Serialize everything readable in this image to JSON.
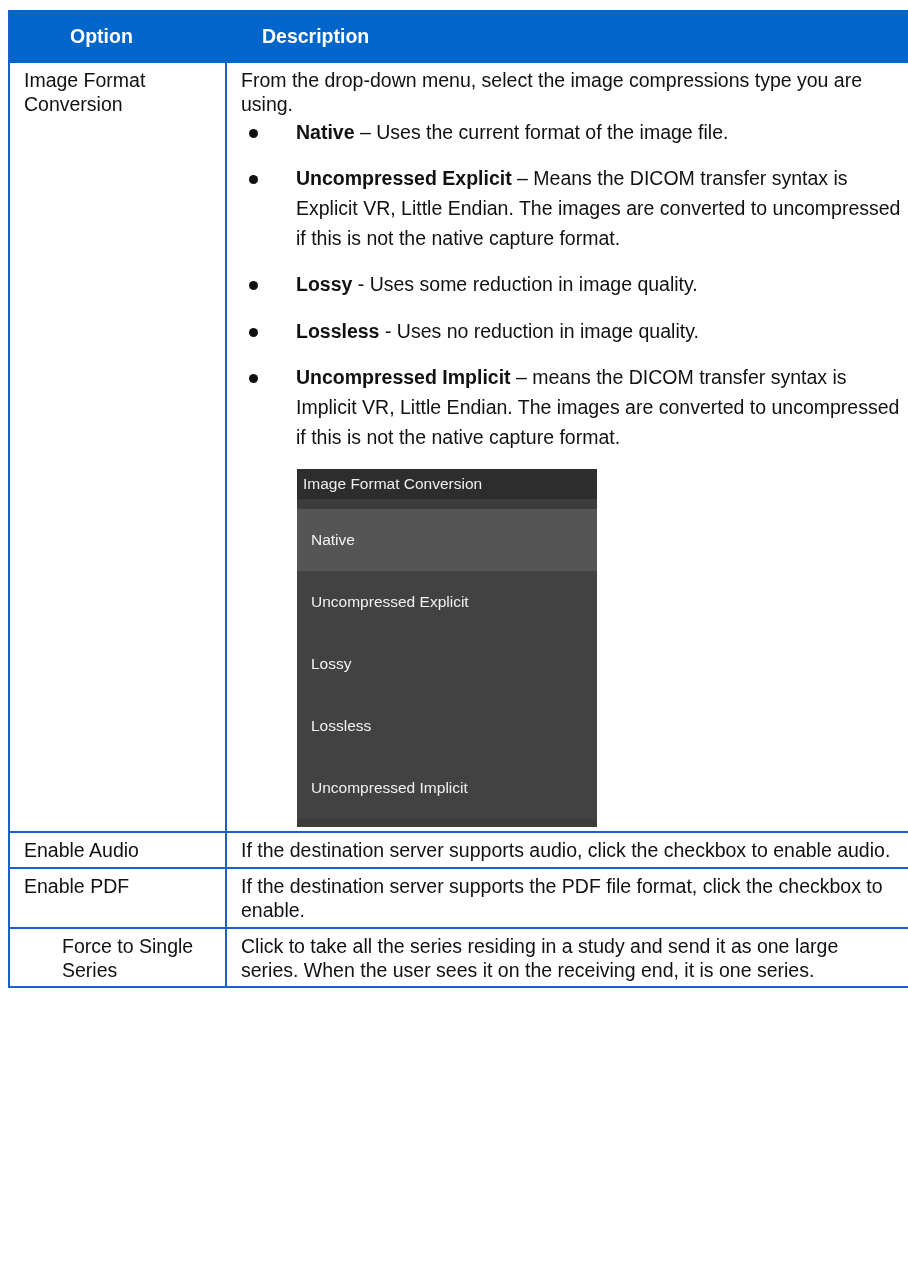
{
  "table": {
    "columns": [
      "Option",
      "Description"
    ],
    "rows": [
      {
        "option": "Image Format Conversion",
        "indented": false,
        "description": "From the drop-down menu, select the image compressions type you are using.",
        "bullets": [
          "**Native** – Uses the current format of the image file.",
          "**Uncompressed Explicit** – Means the DICOM transfer syntax is Explicit VR, Little Endian. The images are converted to uncompressed if this is not the native capture format.",
          "**Lossy** - Uses some reduction in image quality.",
          "**Lossless** - Uses no reduction in image quality.",
          "**Uncompressed Implicit** – means the DICOM transfer syntax is Implicit VR, Little Endian. The images are converted to uncompressed if this is not the native capture format."
        ],
        "dropdown": {
          "title": "Image Format Conversion",
          "options": [
            {
              "label": "Native",
              "selected": true
            },
            {
              "label": "Uncompressed Explicit",
              "selected": false
            },
            {
              "label": "Lossy",
              "selected": false
            },
            {
              "label": "Lossless",
              "selected": false
            },
            {
              "label": "Uncompressed Implicit",
              "selected": false
            }
          ]
        }
      },
      {
        "option": "Enable Audio",
        "indented": false,
        "description": "If the destination server supports audio, click the checkbox to enable audio."
      },
      {
        "option": "Enable PDF",
        "indented": false,
        "description": "If the destination server supports the PDF file format, click the checkbox to enable."
      },
      {
        "option": "Force to Single Series",
        "indented": true,
        "description": "Click to take all the series residing in a study and send it as one large series. When the user sees it on the receiving end, it is one series."
      }
    ]
  }
}
